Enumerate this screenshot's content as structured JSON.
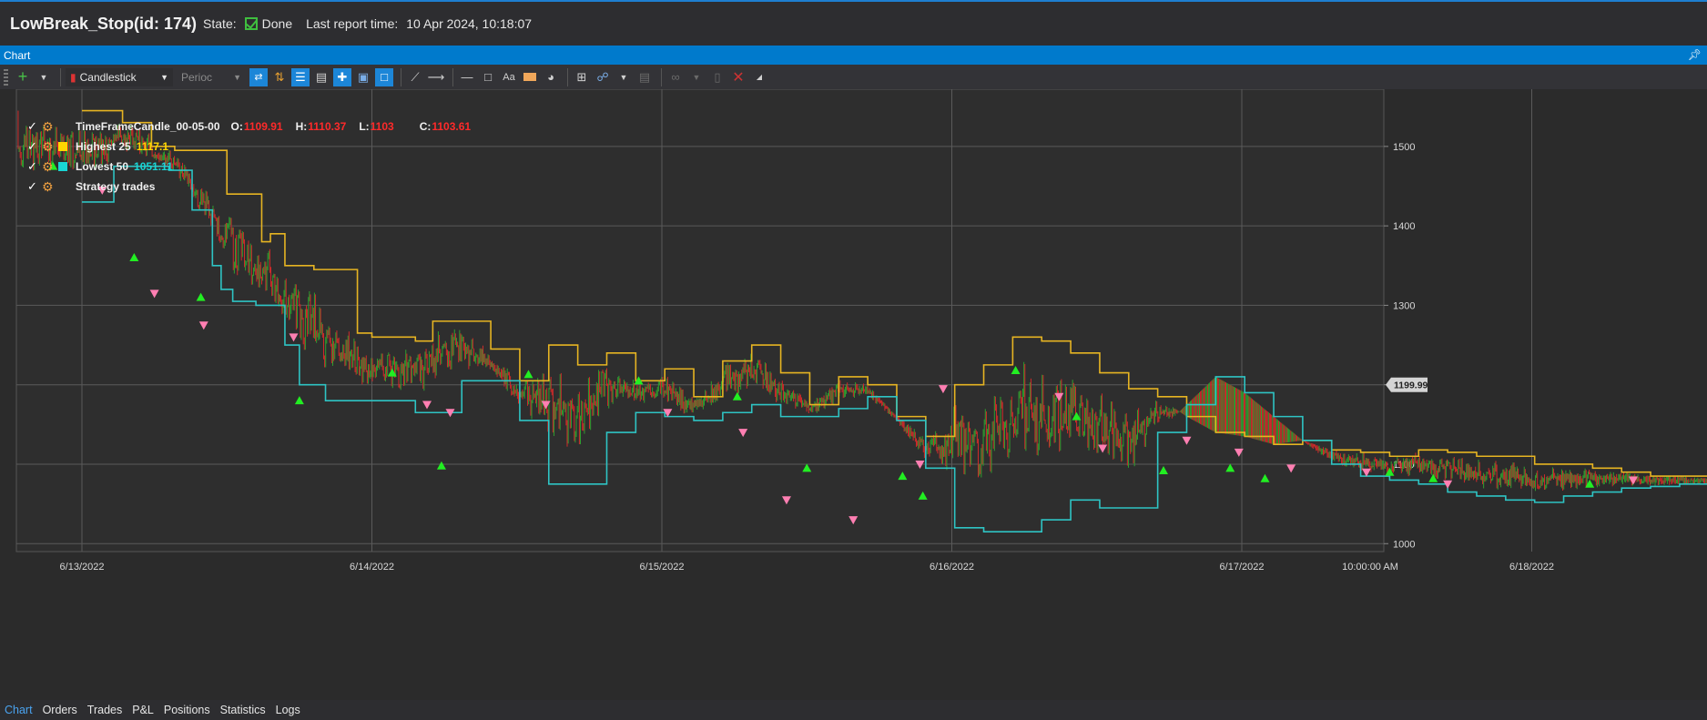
{
  "title": {
    "name": "LowBreak_Stop(id: 174)",
    "state_label": "State:",
    "state_value": "Done",
    "report_label": "Last report time:",
    "report_value": "10 Apr 2024, 10:18:07"
  },
  "panel": {
    "title": "Chart",
    "pin_icon": "pin-icon"
  },
  "toolbar": {
    "chart_style": "Candlestick",
    "period_placeholder": "Perioc",
    "icons": [
      "add-icon",
      "dropdown-icon",
      "candlestick-icon",
      "period-icon",
      "sync-icon",
      "updown-icon",
      "list-icon",
      "table-icon",
      "crosshair-icon",
      "tooltip-icon",
      "step-icon",
      "line-draw-icon",
      "arrow-draw-icon",
      "hline-icon",
      "rectangle-icon",
      "text-icon",
      "fill-icon",
      "gauge-icon",
      "add-panel-icon",
      "share-icon",
      "export-icon",
      "attach-icon",
      "page-icon",
      "close-icon"
    ]
  },
  "legend": {
    "candle": {
      "name": "TimeFrameCandle_00-05-00",
      "o_label": "O:",
      "o": "1109.91",
      "h_label": "H:",
      "h": "1110.37",
      "l_label": "L:",
      "l": "1103",
      "c_label": "C:",
      "c": "1103.61"
    },
    "highest": {
      "name": "Highest 25",
      "value": "1117.1",
      "color": "#ffd700"
    },
    "lowest": {
      "name": "Lowest 50",
      "value": "1051.11",
      "color": "#19d5d5"
    },
    "trades": {
      "name": "Strategy trades"
    }
  },
  "chart_data": {
    "type": "line",
    "x_ticks": [
      "6/13/2022",
      "6/14/2022",
      "6/15/2022",
      "6/16/2022",
      "6/17/2022",
      "6/18/2022",
      "10:00:00 AM"
    ],
    "y_ticks": [
      1000,
      1100,
      1200,
      1300,
      1400,
      1500
    ],
    "ylim": [
      990,
      1572
    ],
    "current_price_label": "1199.99",
    "colors": {
      "highest": "#e6b422",
      "lowest": "#2ec4c4",
      "candle_up": "#2f9e2f",
      "candle_down": "#d12a2a",
      "buy_marker": "#22ee22",
      "sell_marker": "#ff7fb2",
      "grid": "#5a5a5a"
    },
    "series": [
      {
        "name": "Highest 25",
        "x": [
          0.0,
          0.14,
          0.14,
          0.24,
          0.24,
          0.32,
          0.5,
          0.62,
          0.65,
          0.7,
          0.8,
          0.95,
          1.0,
          1.15,
          1.21,
          1.31,
          1.41,
          1.51,
          1.61,
          1.71,
          1.81,
          1.91,
          2.01,
          2.11,
          2.21,
          2.31,
          2.41,
          2.51,
          2.61,
          2.71,
          2.81,
          2.91,
          3.01,
          3.11,
          3.21,
          3.31,
          3.41,
          3.51,
          3.61,
          3.71,
          3.81,
          3.91,
          4.01,
          4.11,
          4.21,
          4.31,
          4.41,
          4.51,
          4.61,
          4.71,
          4.81,
          4.91,
          5.01,
          5.11,
          5.21,
          5.31,
          5.41,
          5.51,
          5.61,
          5.65
        ],
        "values": [
          1545,
          1545,
          1530,
          1530,
          1500,
          1495,
          1440,
          1380,
          1390,
          1350,
          1345,
          1265,
          1260,
          1255,
          1280,
          1280,
          1245,
          1205,
          1250,
          1225,
          1240,
          1205,
          1220,
          1185,
          1230,
          1250,
          1215,
          1175,
          1210,
          1200,
          1160,
          1135,
          1200,
          1225,
          1260,
          1255,
          1240,
          1215,
          1195,
          1185,
          1160,
          1140,
          1135,
          1125,
          1130,
          1118,
          1115,
          1110,
          1118,
          1115,
          1110,
          1110,
          1100,
          1100,
          1095,
          1090,
          1085,
          1085,
          1082,
          1080
        ]
      },
      {
        "name": "Lowest 50",
        "x": [
          0.0,
          0.11,
          0.11,
          0.16,
          0.16,
          0.3,
          0.38,
          0.45,
          0.48,
          0.52,
          0.6,
          0.7,
          0.75,
          0.84,
          1.0,
          1.15,
          1.21,
          1.31,
          1.41,
          1.51,
          1.61,
          1.71,
          1.81,
          1.91,
          2.01,
          2.11,
          2.21,
          2.31,
          2.41,
          2.51,
          2.61,
          2.71,
          2.81,
          2.91,
          3.01,
          3.11,
          3.21,
          3.31,
          3.41,
          3.51,
          3.61,
          3.71,
          3.81,
          3.91,
          4.01,
          4.11,
          4.21,
          4.31,
          4.41,
          4.51,
          4.61,
          4.71,
          4.81,
          4.91,
          5.01,
          5.11,
          5.21,
          5.31,
          5.41,
          5.51,
          5.61,
          5.63
        ],
        "values": [
          1430,
          1430,
          1475,
          1475,
          1475,
          1470,
          1420,
          1350,
          1320,
          1305,
          1300,
          1250,
          1200,
          1180,
          1180,
          1165,
          1165,
          1205,
          1205,
          1155,
          1075,
          1075,
          1140,
          1165,
          1160,
          1155,
          1165,
          1175,
          1160,
          1160,
          1170,
          1185,
          1155,
          1095,
          1020,
          1015,
          1015,
          1030,
          1055,
          1045,
          1045,
          1140,
          1175,
          1210,
          1190,
          1160,
          1130,
          1100,
          1085,
          1080,
          1075,
          1065,
          1060,
          1055,
          1052,
          1060,
          1065,
          1070,
          1072,
          1075,
          1075,
          995
        ]
      }
    ]
  },
  "bottom_tabs": [
    "Chart",
    "Orders",
    "Trades",
    "P&L",
    "Positions",
    "Statistics",
    "Logs"
  ],
  "active_tab": "Chart"
}
